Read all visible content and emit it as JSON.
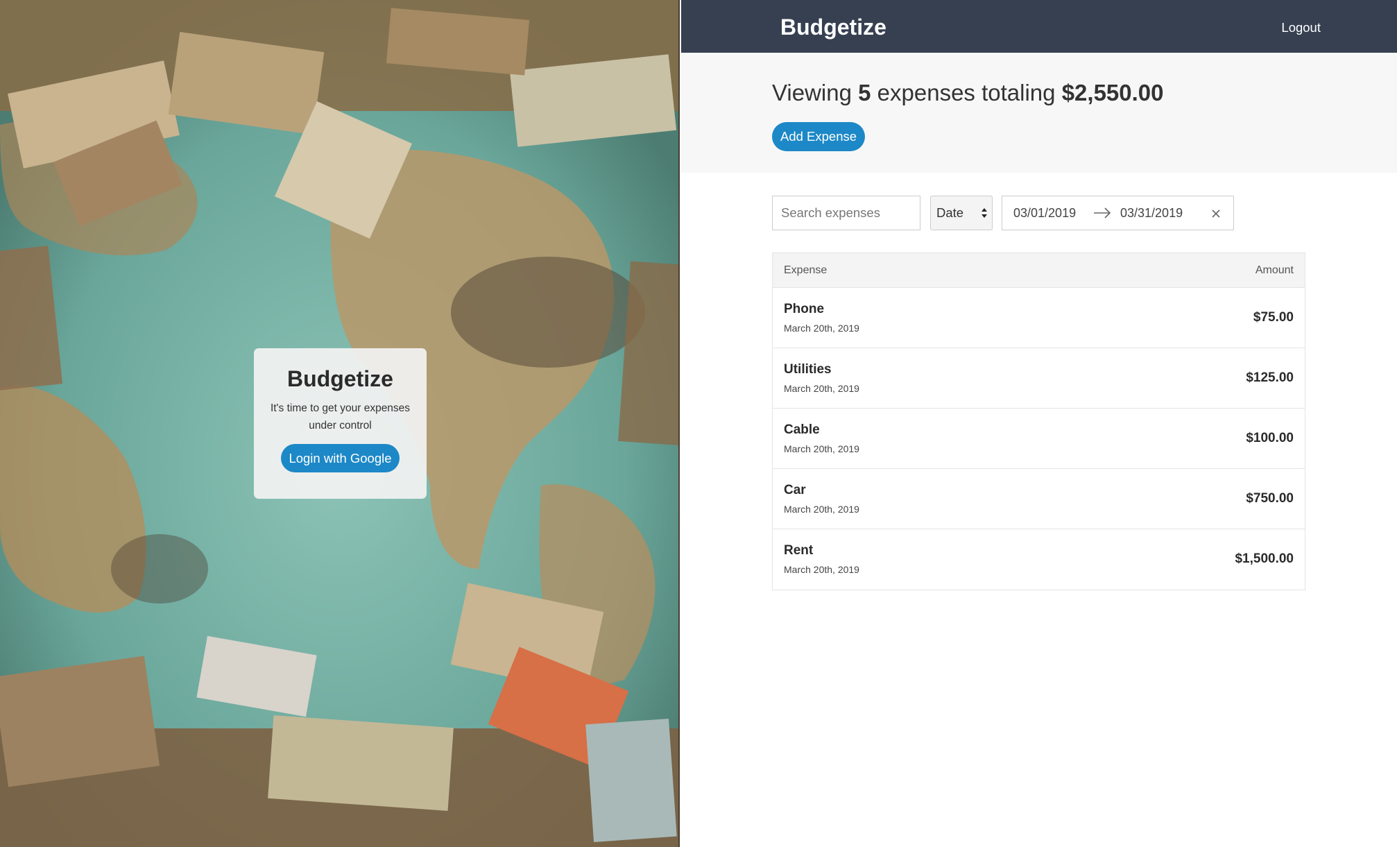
{
  "login": {
    "title": "Budgetize",
    "subtitle": "It's time to get your expenses under control",
    "button_label": "Login with Google"
  },
  "header": {
    "brand": "Budgetize",
    "logout_label": "Logout",
    "background": "#364051"
  },
  "summary": {
    "prefix": "Viewing",
    "count": "5",
    "middle": "expenses totaling",
    "total": "$2,550.00",
    "add_button_label": "Add Expense"
  },
  "filters": {
    "search_placeholder": "Search expenses",
    "sort_value": "Date",
    "start_date": "03/01/2019",
    "end_date": "03/31/2019"
  },
  "table": {
    "headers": {
      "expense": "Expense",
      "amount": "Amount"
    },
    "rows": [
      {
        "name": "Phone",
        "date": "March 20th, 2019",
        "amount": "$75.00"
      },
      {
        "name": "Utilities",
        "date": "March 20th, 2019",
        "amount": "$125.00"
      },
      {
        "name": "Cable",
        "date": "March 20th, 2019",
        "amount": "$100.00"
      },
      {
        "name": "Car",
        "date": "March 20th, 2019",
        "amount": "$750.00"
      },
      {
        "name": "Rent",
        "date": "March 20th, 2019",
        "amount": "$1,500.00"
      }
    ]
  },
  "colors": {
    "accent": "#1c88c7",
    "header": "#364051",
    "summary_bg": "#f7f7f7"
  },
  "icons": {
    "select_arrows": "up-down-caret-icon",
    "date_arrow": "arrow-right-icon",
    "clear": "close-icon"
  }
}
